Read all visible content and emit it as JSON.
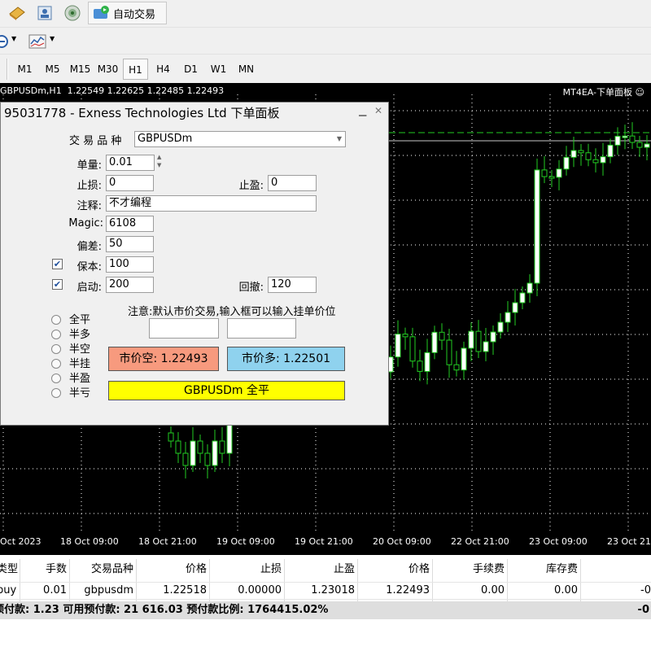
{
  "toolbar": {
    "auto_trade_label": "自动交易"
  },
  "timeframes": [
    {
      "label": "M1",
      "active": false
    },
    {
      "label": "M5",
      "active": false
    },
    {
      "label": "M15",
      "active": false
    },
    {
      "label": "M30",
      "active": false
    },
    {
      "label": "H1",
      "active": true
    },
    {
      "label": "H4",
      "active": false
    },
    {
      "label": "D1",
      "active": false
    },
    {
      "label": "W1",
      "active": false
    },
    {
      "label": "MN",
      "active": false
    }
  ],
  "chart": {
    "title": "GBPUSDm,H1  1.22549 1.22625 1.22485 1.22493",
    "ea_label": "MT4EA-下单面板",
    "x_ticks": [
      "Oct 2023",
      "18 Oct 09:00",
      "18 Oct 21:00",
      "19 Oct 09:00",
      "19 Oct 21:00",
      "20 Oct 09:00",
      "22 Oct 21:00",
      "23 Oct 09:00",
      "23 Oct 21"
    ],
    "colors": {
      "background": "#000000",
      "candle": "#22cc22",
      "grid": "#ffffff"
    }
  },
  "panel": {
    "title": "95031778 - Exness Technologies Ltd 下单面板",
    "symbol_label": "交 易 品 种",
    "symbol_value": "GBPUSDm",
    "lot_label": "单量:",
    "lot_value": "0.01",
    "sl_label": "止损:",
    "sl_value": "0",
    "tp_label": "止盈:",
    "tp_value": "0",
    "comment_label": "注释:",
    "comment_value": "不才编程",
    "magic_label": "Magic:",
    "magic_value": "6108",
    "slippage_label": "偏差:",
    "slippage_value": "50",
    "breakeven_label": "保本:",
    "breakeven_value": "100",
    "breakeven_checked": true,
    "trail_label": "启动:",
    "trail_value": "200",
    "trail_checked": true,
    "pullback_label": "回撤:",
    "pullback_value": "120",
    "note": "注意:默认市价交易,输入框可以输入挂单价位",
    "radios": [
      "全平",
      "半多",
      "半空",
      "半挂",
      "半盈",
      "半亏"
    ],
    "sell_button": "市价空: 1.22493",
    "buy_button": "市价多: 1.22501",
    "close_all_button": "GBPUSDm 全平",
    "colors": {
      "sell": "#f79a7e",
      "buy": "#8fd2ee",
      "close_all": "#ffff00"
    }
  },
  "table": {
    "headers": [
      "类型",
      "手数",
      "交易品种",
      "价格",
      "止损",
      "止盈",
      "价格",
      "手续费",
      "库存费"
    ],
    "row": [
      "buy",
      "0.01",
      "gbpusdm",
      "1.22518",
      "0.00000",
      "1.23018",
      "1.22493",
      "0.00",
      "0.00",
      "-0"
    ],
    "summary": "预付款: 1.23  可用预付款: 21 616.03  预付款比例: 1764415.02%",
    "summary_right": "-0"
  }
}
